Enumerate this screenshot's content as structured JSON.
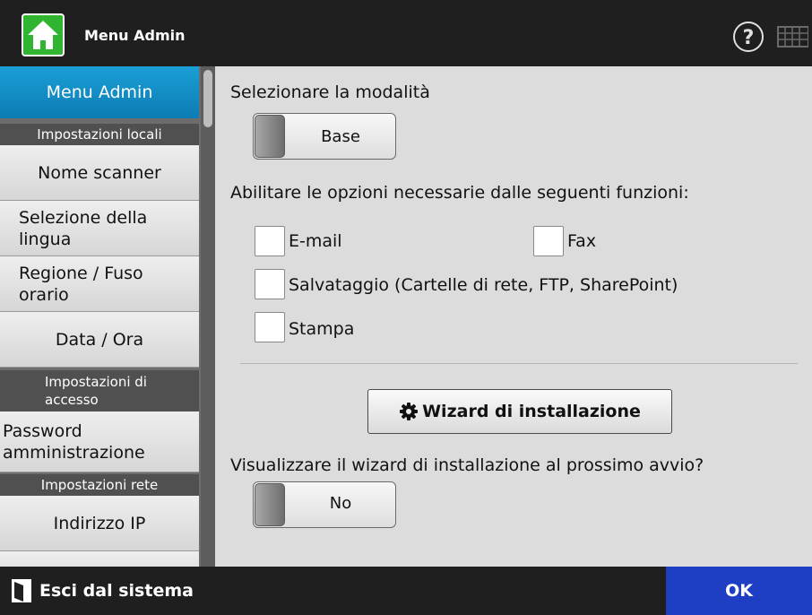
{
  "header": {
    "title": "Menu Admin",
    "home_icon": "home-icon",
    "help_icon": "help-icon",
    "keyboard_icon": "keyboard-icon"
  },
  "sidebar": {
    "active_item": "Menu Admin",
    "sections": [
      "Impostazioni locali",
      "Impostazioni di accesso",
      "Impostazioni rete"
    ],
    "items": [
      "Nome scanner",
      "Selezione della lingua",
      "Regione / Fuso orario",
      "Data / Ora",
      "Password amministrazione",
      "Indirizzo IP"
    ]
  },
  "main": {
    "mode_label": "Selezionare la modalità",
    "mode_value": "Base",
    "options_label": "Abilitare le opzioni necessarie dalle seguenti funzioni:",
    "options": [
      {
        "label": "E-mail",
        "checked": false
      },
      {
        "label": "Fax",
        "checked": false
      },
      {
        "label": "Salvataggio (Cartelle di rete, FTP, SharePoint)",
        "checked": false
      },
      {
        "label": "Stampa",
        "checked": false
      }
    ],
    "wizard_button": "Wizard di installazione",
    "wizard_prompt": "Visualizzare il wizard di installazione al prossimo avvio?",
    "wizard_value": "No"
  },
  "footer": {
    "logout_label": "Esci dal sistema",
    "ok_label": "OK"
  },
  "colors": {
    "accent_blue": "#0d7cb4",
    "ok_blue": "#1e3fc4",
    "home_green": "#2fb52f"
  }
}
